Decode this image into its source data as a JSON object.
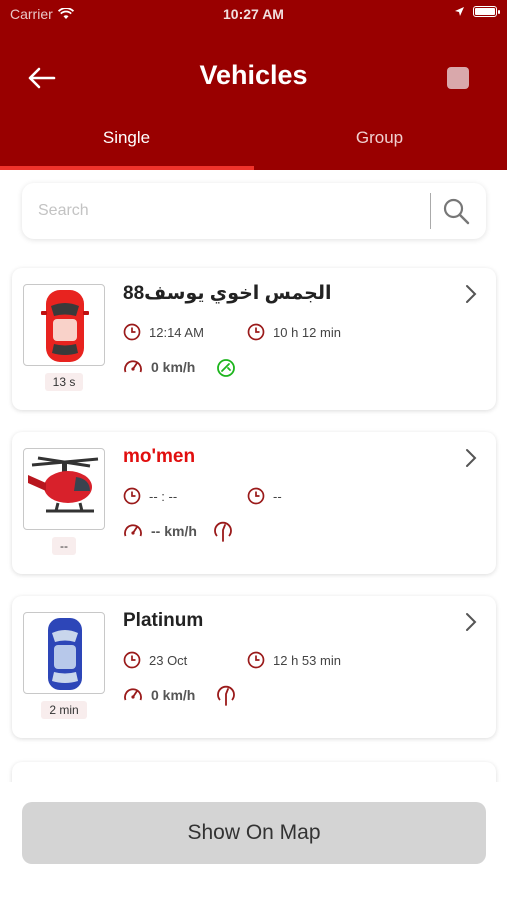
{
  "status_bar": {
    "carrier": "Carrier",
    "time": "10:27 AM"
  },
  "header": {
    "title": "Vehicles",
    "back_icon": "arrow-left-icon",
    "menu_icon": "square-icon"
  },
  "tabs": [
    {
      "label": "Single",
      "active": true
    },
    {
      "label": "Group",
      "active": false
    }
  ],
  "search": {
    "placeholder": "Search",
    "value": ""
  },
  "vehicles": [
    {
      "name": "88الجمس اخوي يوسف",
      "icon": "red-car-icon",
      "age": "13 s",
      "time": "12:14 AM",
      "duration": "10 h 12 min",
      "speed": "0 km/h",
      "ignition": "on",
      "name_color": "#222222"
    },
    {
      "name": "mo'men",
      "icon": "helicopter-icon",
      "age": "--",
      "time": "-- : --",
      "duration": "--",
      "speed": "-- km/h",
      "ignition": "off",
      "name_color": "#e10e0e"
    },
    {
      "name": "Platinum",
      "icon": "blue-car-icon",
      "age": "2 min",
      "time": "23 Oct",
      "duration": "12 h 53 min",
      "speed": "0 km/h",
      "ignition": "off",
      "name_color": "#222222"
    }
  ],
  "footer": {
    "show_on_map": "Show On Map"
  },
  "colors": {
    "primary": "#990000",
    "tab_indicator": "#f0332b",
    "icon_red": "#9a1a1a",
    "ignition_on": "#1db51d"
  }
}
